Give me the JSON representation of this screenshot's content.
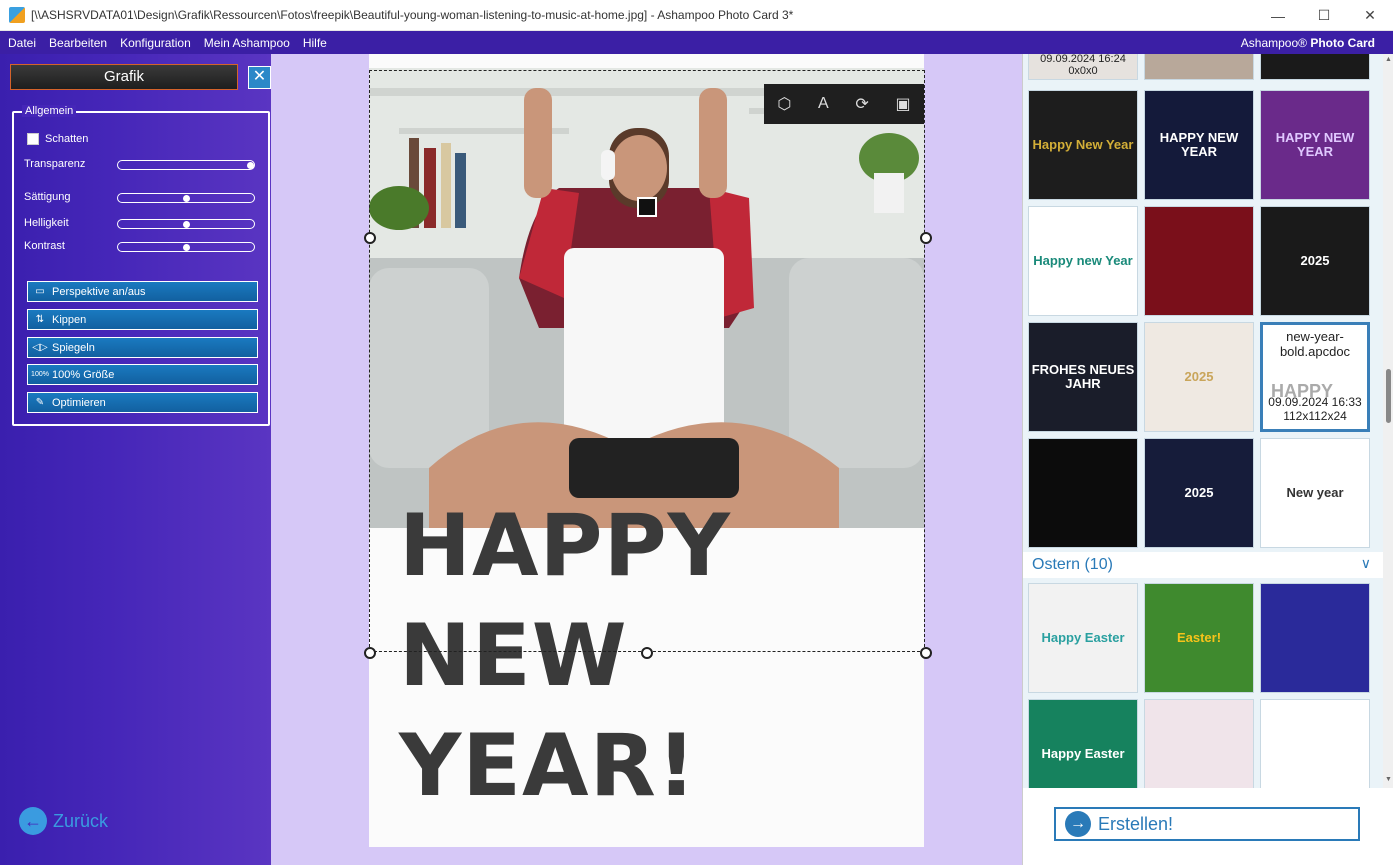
{
  "window": {
    "title": "[\\\\ASHSRVDATA01\\Design\\Grafik\\Ressourcen\\Fotos\\freepik\\Beautiful-young-woman-listening-to-music-at-home.jpg] - Ashampoo Photo Card 3*",
    "minimize": "—",
    "maximize": "☐",
    "close": "✕"
  },
  "menu": {
    "items": [
      "Datei",
      "Bearbeiten",
      "Konfiguration",
      "Mein Ashampoo",
      "Hilfe"
    ],
    "brand_prefix": "Ashampoo®",
    "brand_name": "Photo Card"
  },
  "left_panel": {
    "title": "Grafik",
    "close_icon": "✕",
    "group_label": "Allgemein",
    "shadow_label": "Schatten",
    "sliders": [
      {
        "label": "Transparenz",
        "value": 1.0
      },
      {
        "label": "Sättigung",
        "value": 0.5
      },
      {
        "label": "Helligkeit",
        "value": 0.5
      },
      {
        "label": "Kontrast",
        "value": 0.5
      }
    ],
    "buttons": [
      {
        "label": "Perspektive an/aus",
        "icon": "▭"
      },
      {
        "label": "Kippen",
        "icon": "⇅"
      },
      {
        "label": "Spiegeln",
        "icon": "◁▷"
      },
      {
        "label": "100% Größe",
        "icon": "100%"
      },
      {
        "label": "Optimieren",
        "icon": "✎"
      }
    ],
    "back_label": "Zurück",
    "back_icon": "←"
  },
  "canvas": {
    "headline_line1": "HAPPY",
    "headline_line2": "NEW",
    "headline_line3": "YEAR!",
    "toolbar_icons": [
      "cube-icon",
      "text-icon",
      "replace-icon",
      "image-icon"
    ]
  },
  "right_panel": {
    "top_row": [
      {
        "date": "09.09.2024 16:24",
        "dims": "0x0x0"
      },
      {
        "label": ""
      },
      {
        "label": ""
      }
    ],
    "newyear_thumbs": [
      {
        "text": "Happy New Year",
        "bg": "#1d1d1d",
        "fg": "#d4af37"
      },
      {
        "text": "HAPPY NEW YEAR",
        "bg": "#141a3a",
        "fg": "#ffffff"
      },
      {
        "text": "HAPPY NEW YEAR",
        "bg": "#6a2a8a",
        "fg": "#e0c8ff"
      },
      {
        "text": "Happy new Year",
        "bg": "#ffffff",
        "fg": "#1a8a7a"
      },
      {
        "text": "",
        "bg": "#7a0f1a",
        "fg": "#ffffff"
      },
      {
        "text": "2025",
        "bg": "#1a1a1a",
        "fg": "#ffffff"
      },
      {
        "text": "FROHES NEUES JAHR",
        "bg": "#1a1d2a",
        "fg": "#ffffff"
      },
      {
        "text": "2025",
        "bg": "#efe9e2",
        "fg": "#c9a55a"
      },
      {
        "selected": true,
        "name": "new-year-bold.apcdoc",
        "date": "09.09.2024 16:33",
        "dims": "112x112x24",
        "overlay": "HAPPY"
      },
      {
        "text": "",
        "bg": "#0c0c0c",
        "fg": "#d4af37"
      },
      {
        "text": "2025",
        "bg": "#161c3a",
        "fg": "#ffffff"
      },
      {
        "text": "New year",
        "bg": "#ffffff",
        "fg": "#333333"
      }
    ],
    "section": {
      "title": "Ostern (10)",
      "chevron": "∨"
    },
    "easter_thumbs": [
      {
        "text": "Happy Easter",
        "bg": "#f2f2f2",
        "fg": "#2aa0a0"
      },
      {
        "text": "Easter!",
        "bg": "#3f8a2e",
        "fg": "#f7c31a"
      },
      {
        "text": "",
        "bg": "#2a2a9a",
        "fg": "#ffffff"
      },
      {
        "text": "Happy Easter",
        "bg": "#16825e",
        "fg": "#ffffff"
      },
      {
        "text": "",
        "bg": "#f0e4ea",
        "fg": "#e06090"
      },
      {
        "text": "",
        "bg": "#ffffff",
        "fg": "#c08040"
      }
    ],
    "create_label": "Erstellen!",
    "create_icon": "→"
  }
}
